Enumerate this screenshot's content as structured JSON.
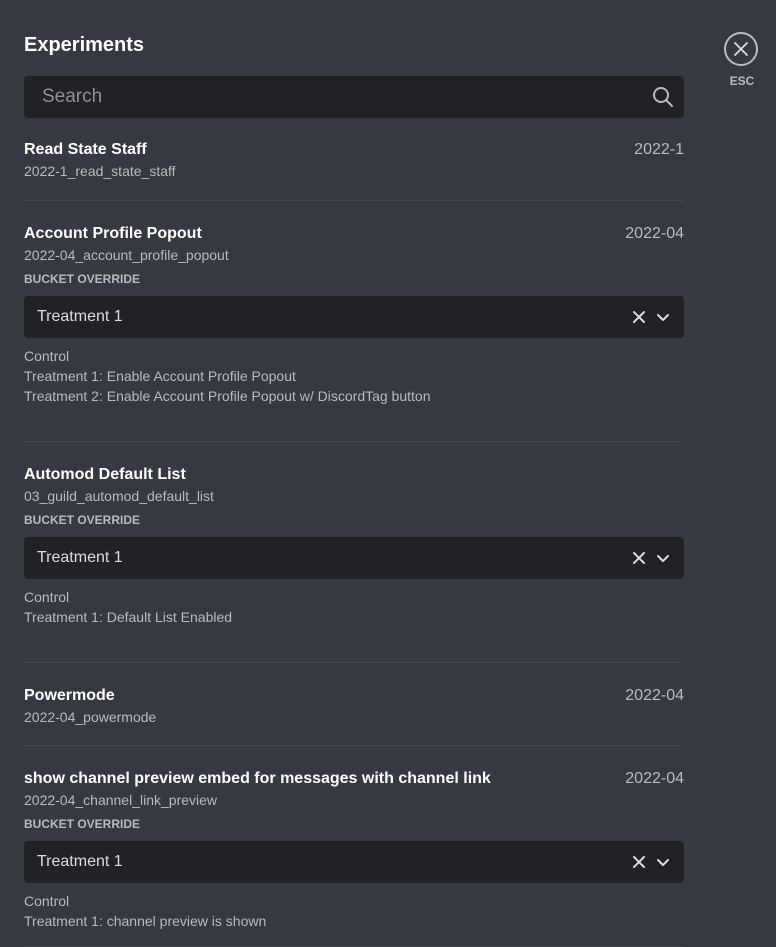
{
  "header": {
    "title": "Experiments"
  },
  "search": {
    "placeholder": "Search"
  },
  "close": {
    "esc_label": "ESC"
  },
  "experiments": [
    {
      "name": "Read State Staff",
      "id": "2022-1_read_state_staff",
      "date": "2022-1"
    },
    {
      "name": "Account Profile Popout",
      "id": "2022-04_account_profile_popout",
      "date": "2022-04",
      "bucket_label": "BUCKET OVERRIDE",
      "selected": "Treatment 1",
      "options": [
        "Control",
        "Treatment 1: Enable Account Profile Popout",
        "Treatment 2: Enable Account Profile Popout w/ DiscordTag button"
      ]
    },
    {
      "name": "Automod Default List",
      "id": "03_guild_automod_default_list",
      "date": "",
      "bucket_label": "BUCKET OVERRIDE",
      "selected": "Treatment 1",
      "options": [
        "Control",
        "Treatment 1: Default List Enabled"
      ]
    },
    {
      "name": "Powermode",
      "id": "2022-04_powermode",
      "date": "2022-04"
    },
    {
      "name": "show channel preview embed for messages with channel link",
      "id": "2022-04_channel_link_preview",
      "date": "2022-04",
      "bucket_label": "BUCKET OVERRIDE",
      "selected": "Treatment 1",
      "options": [
        "Control",
        "Treatment 1: channel preview is shown"
      ]
    }
  ]
}
